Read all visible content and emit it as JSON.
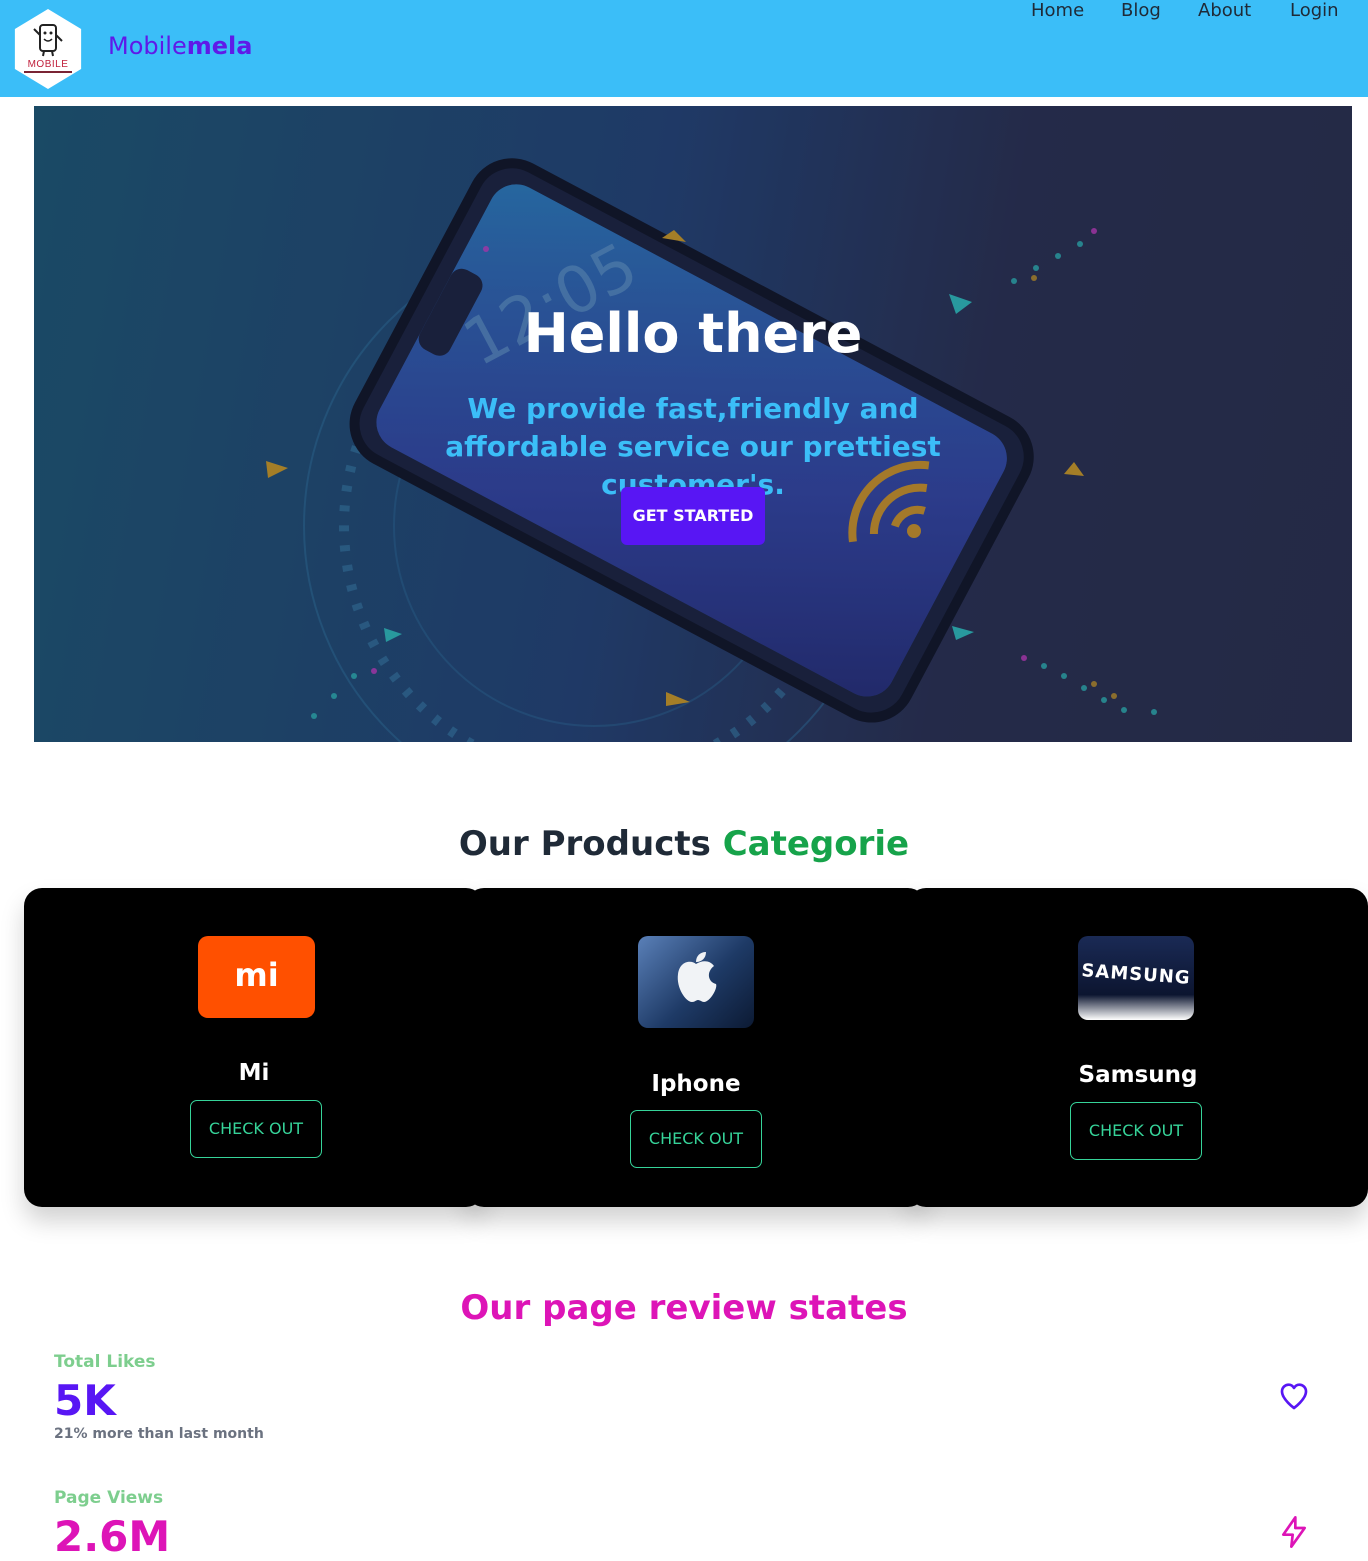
{
  "header": {
    "logo_text": "MOBILE",
    "brand_prefix": "Mobile",
    "brand_suffix": "mela",
    "nav": [
      {
        "label": "Home"
      },
      {
        "label": "Blog"
      },
      {
        "label": "About"
      },
      {
        "label": "Login"
      }
    ]
  },
  "hero": {
    "title": "Hello there",
    "subtitle": "We provide fast,friendly and affordable service our prettiest customer's.",
    "cta_label": "GET STARTED",
    "clock_text": "12:05"
  },
  "products": {
    "title_main": "Our Products",
    "title_accent": "Categorie",
    "cards": [
      {
        "name": "Mi",
        "logo_text": "mi",
        "button": "CHECK OUT",
        "logo_color": "#ff5000"
      },
      {
        "name": "Iphone",
        "logo_text": "",
        "button": "CHECK OUT",
        "logo_color": "#1e3a66"
      },
      {
        "name": "Samsung",
        "logo_text": "SAMSUNG",
        "button": "CHECK OUT",
        "logo_color": "#0c1530"
      }
    ]
  },
  "stats": {
    "title": "Our page review states",
    "items": [
      {
        "label": "Total Likes",
        "value": "5K",
        "description": "21% more than last month",
        "value_color": "#5816f4",
        "icon": "heart-icon"
      },
      {
        "label": "Page Views",
        "value": "2.6M",
        "description": "",
        "value_color": "#dd14b7",
        "icon": "bolt-icon"
      }
    ]
  },
  "colors": {
    "navbar": "#3bbef8",
    "primary": "#5816f4",
    "accent_green": "#16a34a",
    "secondary": "#dd14b7",
    "checkout": "#36d399"
  }
}
